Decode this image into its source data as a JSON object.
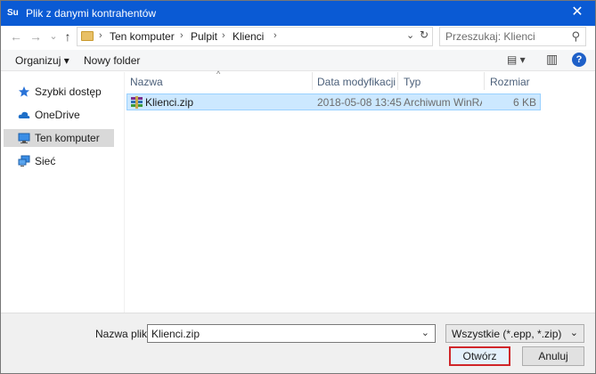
{
  "title_bar": {
    "logo": "Su",
    "title": "Plik z danymi kontrahentów",
    "close": "✕"
  },
  "nav": {
    "back": "←",
    "forward": "→",
    "history": "⌄",
    "up": "↑",
    "breadcrumbs": [
      "Ten komputer",
      "Pulpit",
      "Klienci"
    ],
    "address_dropdown": "⌄",
    "refresh": "↻",
    "search_placeholder": "Przeszukaj: Klienci"
  },
  "toolbar": {
    "organize": "Organizuj ▾",
    "new_folder": "Nowy folder",
    "view": "▤ ▾",
    "preview": "▥",
    "help": "?"
  },
  "sidebar": {
    "items": [
      {
        "label": "Szybki dostęp",
        "icon": "star-icon"
      },
      {
        "label": "OneDrive",
        "icon": "cloud-icon"
      },
      {
        "label": "Ten komputer",
        "icon": "computer-icon",
        "selected": true
      },
      {
        "label": "Sieć",
        "icon": "network-icon"
      }
    ]
  },
  "files": {
    "columns": [
      "Nazwa",
      "Data modyfikacji",
      "Typ",
      "Rozmiar"
    ],
    "sort_indicator": "^",
    "rows": [
      {
        "name": "Klienci.zip",
        "date": "2018-05-08 13:45",
        "type": "Archiwum WinRA...",
        "size": "6 KB",
        "icon": "winrar-archive-icon"
      }
    ]
  },
  "footer": {
    "filename_label": "Nazwa pliku:",
    "filename_value": "Klienci.zip",
    "filename_dropdown": "⌄",
    "filter_value": "Wszystkie (*.epp, *.zip)",
    "filter_dropdown": "⌄",
    "open_label": "Otwórz",
    "cancel_label": "Anuluj"
  },
  "colors": {
    "titlebar": "#0a5ad4",
    "selection": "#cce8ff",
    "open_button_border": "#d0262a"
  }
}
